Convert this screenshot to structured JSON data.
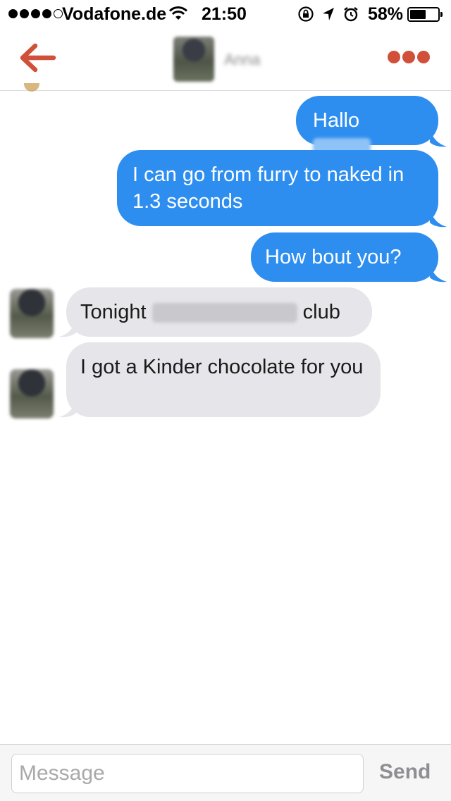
{
  "status_bar": {
    "carrier": "Vodafone.de",
    "time": "21:50",
    "battery_percent": "58%",
    "battery_level": 0.58,
    "signal_bars": 4,
    "signal_max": 5
  },
  "nav": {
    "contact_name": "Anna",
    "back_icon": "arrow-left-icon",
    "more_icon": "more-dots-icon",
    "accent_color": "#d1503a"
  },
  "messages": {
    "m1": {
      "prefix": "Hallo",
      "redacted": "Anna"
    },
    "m2": {
      "text": "I can go from furry to naked in 1.3 seconds"
    },
    "m3": {
      "text": "How bout you?"
    },
    "m4": {
      "prefix": "Tonight",
      "redacted": "Farbfernseher",
      "suffix": "club"
    },
    "m5": {
      "text": "I got a Kinder chocolate for you"
    }
  },
  "colors": {
    "outgoing_bubble": "#2e8ef0",
    "incoming_bubble": "#e5e5ea"
  },
  "composer": {
    "placeholder": "Message",
    "send_label": "Send"
  }
}
